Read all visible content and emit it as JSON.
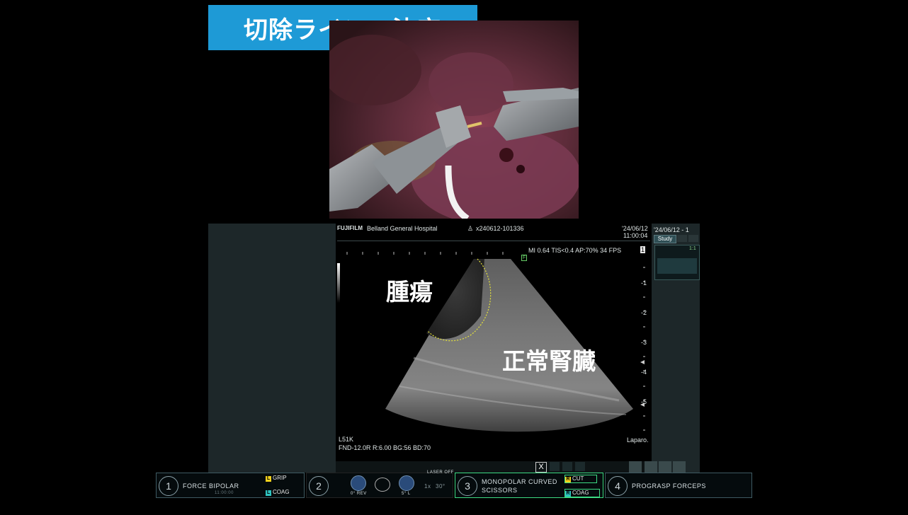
{
  "title": "切除ラインの決定",
  "ultrasound": {
    "brand": "FUJIFILM",
    "hospital": "Belland General Hospital",
    "patient_id": "x240612-101336",
    "date": "'24/06/12",
    "time": "11:00:04",
    "params": "MI 0.64  TIS<0.4   AP:70%    34 FPS",
    "fps_mark": "1",
    "focus_marker": "F",
    "probe": "L51K",
    "settings": "FND-12.0R   R:6.00  BG:56   BD:70",
    "mode": "Laparo.",
    "depth_ticks": [
      "-1",
      "-2",
      "-3",
      "-4",
      "-5"
    ],
    "annotation_tumor": "腫瘍",
    "annotation_kidney": "正常腎臓",
    "side_date": "'24/06/12 - 1",
    "side_study": "Study",
    "side_ratio": "1:1",
    "close_label": "X"
  },
  "instruments": {
    "arm1": {
      "number": "1",
      "name": "FORCE BIPOLAR",
      "sub": "11:00:00",
      "tag1": "GRIP",
      "tag1_key": "L",
      "tag2": "COAG",
      "tag2_key": "L"
    },
    "arm2": {
      "number": "2",
      "laser": "LASER OFF",
      "rev": "0° REV",
      "angle": "5° L",
      "zoom": "1x",
      "scope": "30°"
    },
    "arm3": {
      "number": "3",
      "name": "MONOPOLAR CURVED",
      "name2": "SCISSORS",
      "tag1": "CUT",
      "tag1_key": "R",
      "tag2": "COAG",
      "tag2_key": "R"
    },
    "arm4": {
      "number": "4",
      "name": "PROGRASP FORCEPS"
    }
  },
  "colors": {
    "title_bg": "#1e9ad6",
    "tag_yellow": "#f2d21c",
    "tag_teal": "#2ec3c0",
    "active_green": "#3ddc84"
  }
}
